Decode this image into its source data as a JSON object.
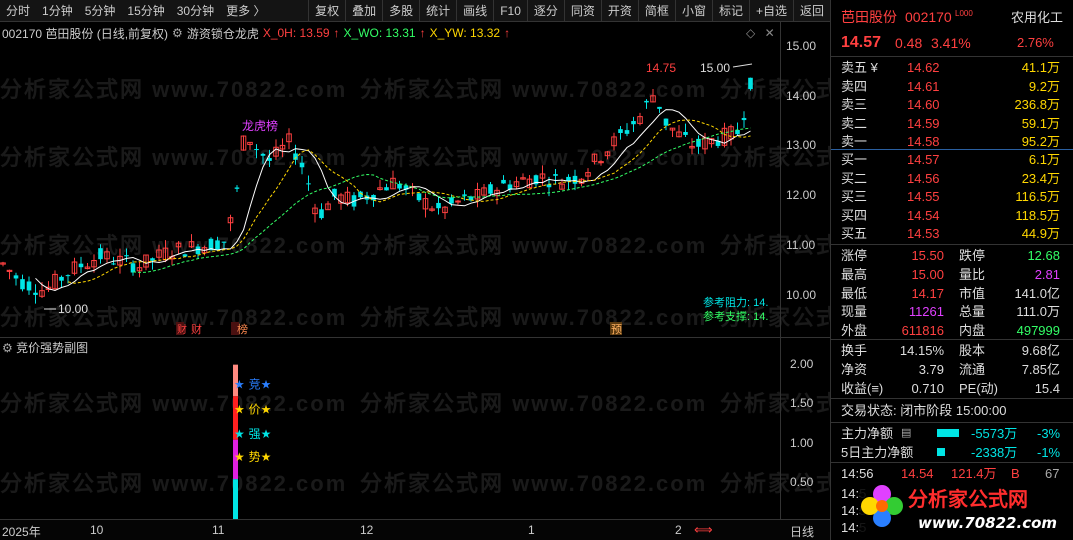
{
  "toolbar": {
    "left_items": [
      "分时",
      "1分钟",
      "5分钟",
      "15分钟",
      "30分钟",
      "更多 〉"
    ],
    "right_items": [
      "复权",
      "叠加",
      "多股",
      "统计",
      "画线",
      "F10",
      "逐分",
      "同资",
      "开资",
      "简框",
      "小窗",
      "标记",
      "+自选",
      "返回"
    ]
  },
  "main_info": {
    "code_name": "002170 芭田股份 (日线,前复权)",
    "indicator": "游资锁仓龙虎",
    "x0h": "X_0H: 13.59",
    "xwo": "X_WO: 13.31",
    "xyw": "X_YW: 13.32"
  },
  "main_axis": {
    "ticks": [
      "15.00",
      "14.00",
      "13.00",
      "12.00",
      "11.00",
      "10.00"
    ]
  },
  "annotations": {
    "high_label": "14.75",
    "right_high": "15.00",
    "low_label": "10.00",
    "dragon": "龙虎榜",
    "resistance": "参考阻力: 14.",
    "support": "参考支撑: 14.",
    "cai": "财",
    "bang": "榜",
    "yu": "预"
  },
  "sub_info": {
    "title": "竞价强势副图"
  },
  "sub_axis": {
    "ticks": [
      "2.00",
      "1.50",
      "1.00",
      "0.50"
    ]
  },
  "sub_labels": [
    "★ 竞★",
    "★ 价★",
    "★ 强★",
    "★ 势★"
  ],
  "date_axis": {
    "labels": [
      "2025年",
      "10",
      "11",
      "12",
      "1",
      "2"
    ],
    "period": "日线"
  },
  "watermark": "分析家公式网 www.70822.com",
  "panel": {
    "name": "芭田股份",
    "code": "002170",
    "industry": "农用化工",
    "price": "14.57",
    "change": "0.48",
    "change_pct": "3.41%",
    "industry_pct": "2.76%",
    "asks": [
      {
        "label": "卖五 ¥",
        "price": "14.62",
        "vol": "41.1万"
      },
      {
        "label": "卖四",
        "price": "14.61",
        "vol": "9.2万"
      },
      {
        "label": "卖三",
        "price": "14.60",
        "vol": "236.8万"
      },
      {
        "label": "卖二",
        "price": "14.59",
        "vol": "59.1万"
      },
      {
        "label": "卖一",
        "price": "14.58",
        "vol": "95.2万"
      }
    ],
    "bids": [
      {
        "label": "买一",
        "price": "14.57",
        "vol": "6.1万"
      },
      {
        "label": "买二",
        "price": "14.56",
        "vol": "23.4万"
      },
      {
        "label": "买三",
        "price": "14.55",
        "vol": "116.5万"
      },
      {
        "label": "买四",
        "price": "14.54",
        "vol": "118.5万"
      },
      {
        "label": "买五",
        "price": "14.53",
        "vol": "44.9万"
      }
    ],
    "stats": [
      {
        "l1": "涨停",
        "v1": "15.50",
        "l2": "跌停",
        "v2": "12.68"
      },
      {
        "l1": "最高",
        "v1": "15.00",
        "l2": "量比",
        "v2": "2.81"
      },
      {
        "l1": "最低",
        "v1": "14.17",
        "l2": "市值",
        "v2": "141.0亿"
      },
      {
        "l1": "现量",
        "v1": "11261",
        "l2": "总量",
        "v2": "111.0万"
      },
      {
        "l1": "外盘",
        "v1": "611816",
        "l2": "内盘",
        "v2": "497999"
      }
    ],
    "stats2": [
      {
        "l1": "换手",
        "v1": "14.15%",
        "l2": "股本",
        "v2": "9.68亿"
      },
      {
        "l1": "净资",
        "v1": "3.79",
        "l2": "流通",
        "v2": "7.85亿"
      },
      {
        "l1": "收益(≡)",
        "v1": "0.710",
        "l2": "PE(动)",
        "v2": "15.4"
      }
    ],
    "trade_status": "交易状态: 闭市阶段 15:00:00",
    "main_net": {
      "label": "主力净额",
      "value": "-5573万",
      "pct": "-3%"
    },
    "five_net": {
      "label": "5日主力净额",
      "value": "-2338万",
      "pct": "-1%"
    },
    "tick": {
      "time": "14:56",
      "price": "14.54",
      "vol": "121.4万",
      "side": "B",
      "num": "67"
    },
    "tick_times": [
      "14:5",
      "14:5",
      "14:5"
    ]
  },
  "logo": {
    "text": "分析家公式网",
    "url": "www.70822.com"
  },
  "colors": {
    "up": "#ff4040",
    "down": "#00e5e5",
    "ma1": "#ffffff",
    "ma2": "#ffd700",
    "ma3": "#33ff66"
  }
}
